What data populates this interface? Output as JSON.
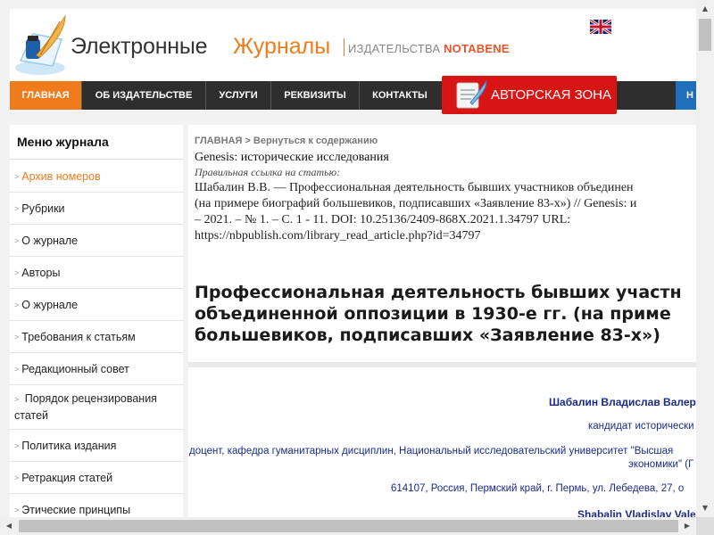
{
  "header": {
    "logo_word1": "Электронные",
    "logo_word2": "Журналы",
    "publisher_prefix": "ИЗДАТЕЛЬСТВА",
    "publisher_name": "NOTABENE",
    "lang_icon": "uk-flag-icon"
  },
  "nav": {
    "items": [
      {
        "label": "ГЛАВНАЯ"
      },
      {
        "label": "ОБ ИЗДАТЕЛЬСТВЕ"
      },
      {
        "label": "УСЛУГИ"
      },
      {
        "label": "РЕКВИЗИТЫ"
      },
      {
        "label": "КОНТАКТЫ"
      }
    ],
    "author_zone": "АВТОРСКАЯ ЗОНА",
    "cut_label": "Н"
  },
  "sidebar": {
    "title": "Меню журнала",
    "items": [
      {
        "label": "Архив номеров"
      },
      {
        "label": "Рубрики"
      },
      {
        "label": "О журнале"
      },
      {
        "label": "Авторы"
      },
      {
        "label": "О журнале"
      },
      {
        "label": "Требования к статьям"
      },
      {
        "label": "Редакционный совет"
      },
      {
        "label": "Порядок рецензирования статей"
      },
      {
        "label": "Политика издания"
      },
      {
        "label": "Ретракция статей"
      },
      {
        "label": "Этические принципы"
      }
    ]
  },
  "content": {
    "breadcrumb": "ГЛАВНАЯ > Вернуться к содержанию",
    "journal_title": "Genesis: исторические исследования",
    "cite_label": "Правильная ссылка на статью:",
    "cite_lines": [
      "Шабалин В.В. — Профессиональная деятельность бывших участников объединен",
      "(на примере биографий большевиков, подписавших «Заявление 83-х») // Genesis: и",
      "– 2021. – № 1. – С. 1 - 11. DOI: 10.25136/2409-868X.2021.1.34797 URL:",
      "https://nbpublish.com/library_read_article.php?id=34797"
    ],
    "article_title_lines": [
      "Профессиональная деятельность бывших участн",
      "объединенной оппозиции в 1930-е гг. (на приме",
      "большевиков, подписавших «Заявление 83-х»)"
    ],
    "author_name": "Шабалин Владислав Валер",
    "author_degree": "кандидат исторически",
    "author_position_1": "доцент, кафедра гуманитарных дисциплин, Национальный исследовательский университет \"Высшая",
    "author_position_2": "экономики\" (Г",
    "author_address": "614107, Россия, Пермский край, г. Пермь, ул. Лебедева, 27, о",
    "author_name_en": "Shabalin Vladislav Vale"
  }
}
